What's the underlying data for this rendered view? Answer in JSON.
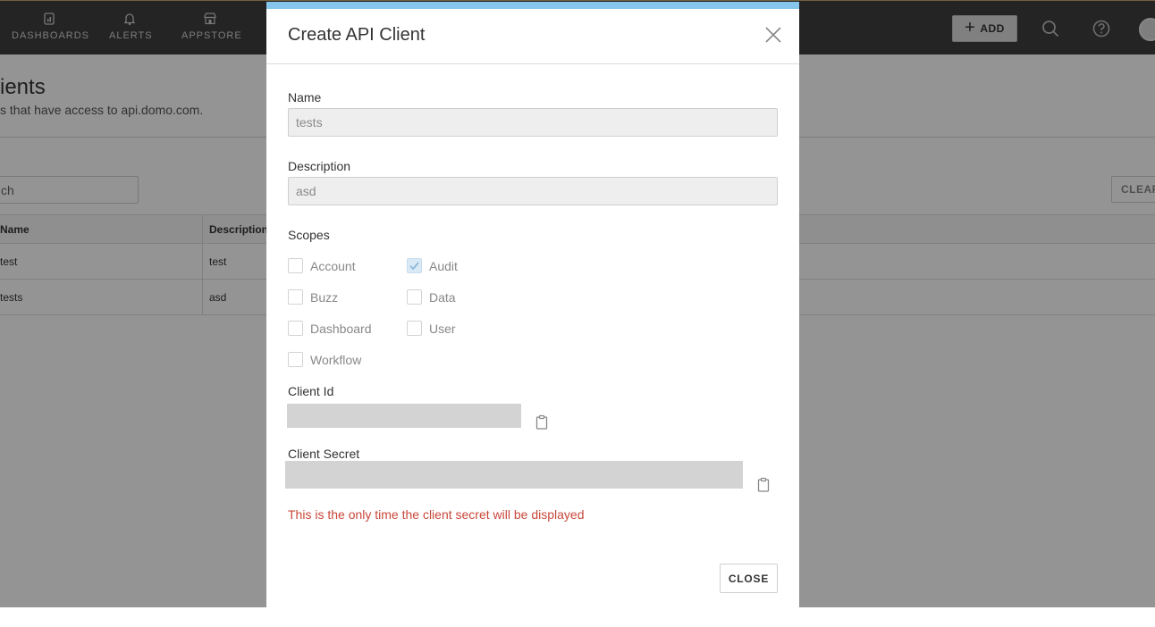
{
  "nav": {
    "items": [
      {
        "label": "DASHBOARDS",
        "icon": "dashboard-icon"
      },
      {
        "label": "ALERTS",
        "icon": "bell-icon"
      },
      {
        "label": "APPSTORE",
        "icon": "store-icon"
      }
    ],
    "add_label": "ADD",
    "icons": [
      "search-icon",
      "help-icon",
      "avatar"
    ]
  },
  "page": {
    "title": "ients",
    "subtitle": "s that have access to api.domo.com.",
    "search_placeholder": "ch",
    "clear_label": "CLEAR",
    "table": {
      "headers": [
        "Name",
        "Description"
      ],
      "rows": [
        [
          "test",
          "test"
        ],
        [
          "tests",
          "asd"
        ]
      ]
    }
  },
  "modal": {
    "title": "Create API Client",
    "name_label": "Name",
    "name_value": "tests",
    "description_label": "Description",
    "description_value": "asd",
    "scopes_label": "Scopes",
    "scopes": [
      {
        "label": "Account",
        "checked": false
      },
      {
        "label": "Audit",
        "checked": true
      },
      {
        "label": "Buzz",
        "checked": false
      },
      {
        "label": "Data",
        "checked": false
      },
      {
        "label": "Dashboard",
        "checked": false
      },
      {
        "label": "User",
        "checked": false
      },
      {
        "label": "Workflow",
        "checked": false
      }
    ],
    "client_id_label": "Client Id",
    "client_secret_label": "Client Secret",
    "warning": "This is the only time the client secret will be displayed",
    "close_label": "CLOSE",
    "accent_color": "#86c6ec",
    "warning_color": "#c9473a"
  }
}
